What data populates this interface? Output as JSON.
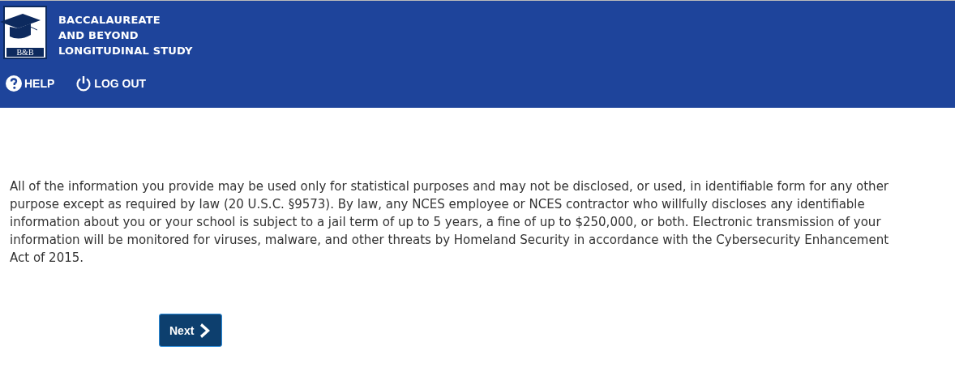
{
  "header": {
    "logo_text": "B&B",
    "title_lines": [
      "BACCALAUREATE",
      "AND BEYOND",
      "LONGITUDINAL STUDY"
    ],
    "nav": [
      {
        "kind": "help",
        "label": "HELP"
      },
      {
        "kind": "logout",
        "label": "LOG OUT"
      }
    ]
  },
  "notice": "All of the information you provide may be used only for statistical purposes and may not be disclosed, or used, in identifiable form for any other purpose except as required by law (20 U.S.C. §9573). By law, any NCES employee or NCES contractor who willfully discloses any identifiable information about you or your school is subject to a jail term of up to 5 years, a fine of up to $250,000, or both. Electronic transmission of your information will be monitored for viruses, malware, and other threats by Homeland Security in accordance with the Cybersecurity Enhancement Act of 2015.",
  "next_button": {
    "label": "Next"
  }
}
